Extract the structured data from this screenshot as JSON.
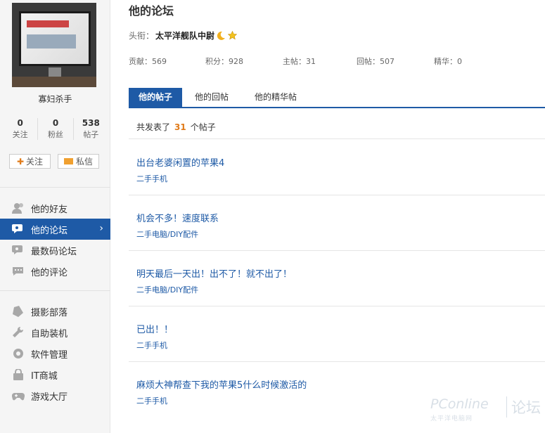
{
  "sidebar": {
    "username": "寡妇杀手",
    "stats": [
      {
        "value": "0",
        "label": "关注"
      },
      {
        "value": "0",
        "label": "粉丝"
      },
      {
        "value": "538",
        "label": "帖子"
      }
    ],
    "follow_label": "关注",
    "message_label": "私信",
    "nav_primary": [
      {
        "label": "他的好友",
        "icon": "friends-icon"
      },
      {
        "label": "他的论坛",
        "icon": "forum-icon",
        "active": true
      },
      {
        "label": "最数码论坛",
        "icon": "digital-forum-icon"
      },
      {
        "label": "他的评论",
        "icon": "comment-icon"
      }
    ],
    "nav_secondary": [
      {
        "label": "摄影部落",
        "icon": "photo-icon"
      },
      {
        "label": "自助装机",
        "icon": "wrench-icon"
      },
      {
        "label": "软件管理",
        "icon": "software-icon"
      },
      {
        "label": "IT商城",
        "icon": "shop-icon"
      },
      {
        "label": "游戏大厅",
        "icon": "gamepad-icon"
      }
    ],
    "active_arrow": "›"
  },
  "main": {
    "title": "他的论坛",
    "rank_label": "头衔：",
    "rank_value": "太平洋舰队中尉",
    "infos": [
      {
        "label": "贡献：569"
      },
      {
        "label": "积分：928"
      },
      {
        "label": "主帖：31"
      },
      {
        "label": "回帖：507"
      },
      {
        "label": "精华：0"
      }
    ],
    "tabs": [
      {
        "label": "他的帖子",
        "active": true
      },
      {
        "label": "他的回帖"
      },
      {
        "label": "他的精华帖"
      }
    ],
    "count_prefix": "共发表了",
    "count_value": "31",
    "count_suffix": "个帖子",
    "posts": [
      {
        "title": "出台老婆闲置的苹果4",
        "category": "二手手机"
      },
      {
        "title": "机会不多！速度联系",
        "category": "二手电脑/DIY配件"
      },
      {
        "title": "明天最后一天出！出不了！就不出了！",
        "category": "二手电脑/DIY配件"
      },
      {
        "title": "已出！！",
        "category": "二手手机"
      },
      {
        "title": "麻烦大神帮查下我的苹果5什么时候激活的",
        "category": "二手手机"
      }
    ]
  },
  "watermark": {
    "brand": "PConline",
    "sub": "太平洋电脑网",
    "forum": "论坛"
  },
  "colors": {
    "accent": "#1e5aa6",
    "highlight": "#e07b1a",
    "link": "#1e5aa6"
  }
}
